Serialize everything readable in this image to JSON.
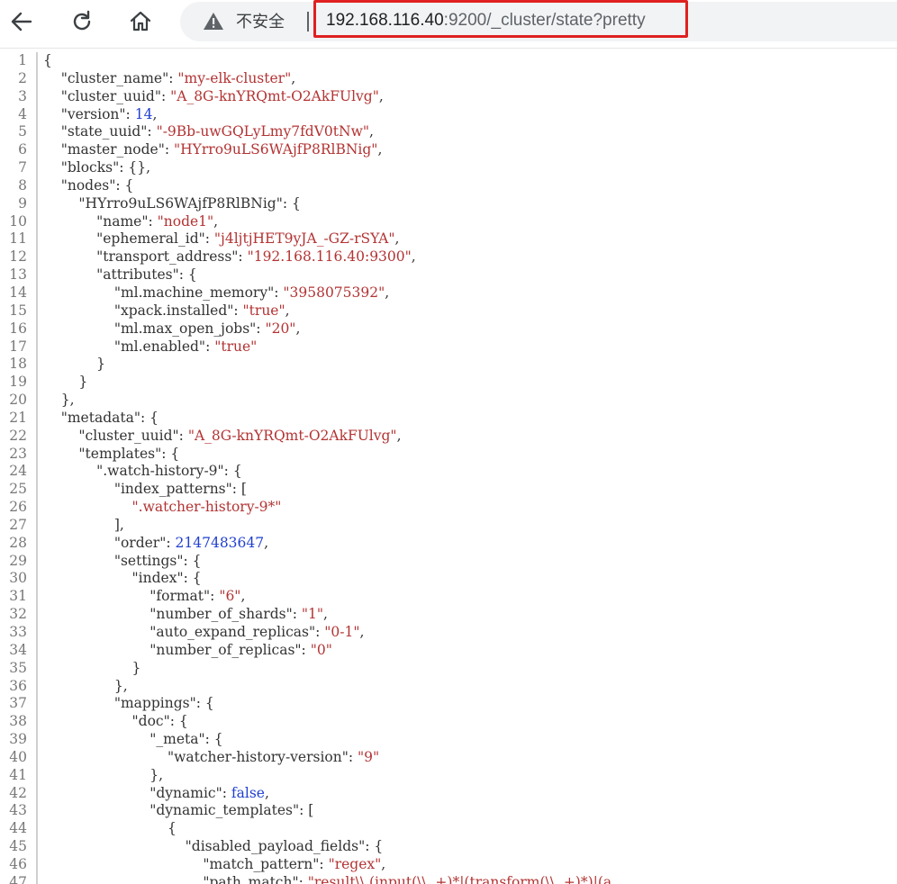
{
  "toolbar": {
    "security_label": "不安全",
    "url_host": "192.168.116.40",
    "url_path": ":9200/_cluster/state?pretty"
  },
  "colors": {
    "highlight_border": "#e02020",
    "string": "#b33333",
    "number": "#1f3fd0",
    "key": "#333333"
  },
  "icons": [
    "back-arrow-icon",
    "reload-icon",
    "home-icon",
    "warning-icon"
  ],
  "lines": [
    {
      "n": "1",
      "t": [
        [
          "p",
          "{"
        ]
      ]
    },
    {
      "n": "2",
      "t": [
        [
          "p",
          "    "
        ],
        [
          "k",
          "\"cluster_name\""
        ],
        [
          "p",
          ": "
        ],
        [
          "s",
          "\"my-elk-cluster\""
        ],
        [
          "p",
          ","
        ]
      ]
    },
    {
      "n": "3",
      "t": [
        [
          "p",
          "    "
        ],
        [
          "k",
          "\"cluster_uuid\""
        ],
        [
          "p",
          ": "
        ],
        [
          "s",
          "\"A_8G-knYRQmt-O2AkFUlvg\""
        ],
        [
          "p",
          ","
        ]
      ]
    },
    {
      "n": "4",
      "t": [
        [
          "p",
          "    "
        ],
        [
          "k",
          "\"version\""
        ],
        [
          "p",
          ": "
        ],
        [
          "n",
          "14"
        ],
        [
          "p",
          ","
        ]
      ]
    },
    {
      "n": "5",
      "t": [
        [
          "p",
          "    "
        ],
        [
          "k",
          "\"state_uuid\""
        ],
        [
          "p",
          ": "
        ],
        [
          "s",
          "\"-9Bb-uwGQLyLmy7fdV0tNw\""
        ],
        [
          "p",
          ","
        ]
      ]
    },
    {
      "n": "6",
      "t": [
        [
          "p",
          "    "
        ],
        [
          "k",
          "\"master_node\""
        ],
        [
          "p",
          ": "
        ],
        [
          "s",
          "\"HYrro9uLS6WAjfP8RlBNig\""
        ],
        [
          "p",
          ","
        ]
      ]
    },
    {
      "n": "7",
      "t": [
        [
          "p",
          "    "
        ],
        [
          "k",
          "\"blocks\""
        ],
        [
          "p",
          ": {},"
        ]
      ]
    },
    {
      "n": "8",
      "t": [
        [
          "p",
          "    "
        ],
        [
          "k",
          "\"nodes\""
        ],
        [
          "p",
          ": {"
        ]
      ]
    },
    {
      "n": "9",
      "t": [
        [
          "p",
          "        "
        ],
        [
          "k",
          "\"HYrro9uLS6WAjfP8RlBNig\""
        ],
        [
          "p",
          ": {"
        ]
      ]
    },
    {
      "n": "10",
      "t": [
        [
          "p",
          "            "
        ],
        [
          "k",
          "\"name\""
        ],
        [
          "p",
          ": "
        ],
        [
          "s",
          "\"node1\""
        ],
        [
          "p",
          ","
        ]
      ]
    },
    {
      "n": "11",
      "t": [
        [
          "p",
          "            "
        ],
        [
          "k",
          "\"ephemeral_id\""
        ],
        [
          "p",
          ": "
        ],
        [
          "s",
          "\"j4ljtjHET9yJA_-GZ-rSYA\""
        ],
        [
          "p",
          ","
        ]
      ]
    },
    {
      "n": "12",
      "t": [
        [
          "p",
          "            "
        ],
        [
          "k",
          "\"transport_address\""
        ],
        [
          "p",
          ": "
        ],
        [
          "s",
          "\"192.168.116.40:9300\""
        ],
        [
          "p",
          ","
        ]
      ]
    },
    {
      "n": "13",
      "t": [
        [
          "p",
          "            "
        ],
        [
          "k",
          "\"attributes\""
        ],
        [
          "p",
          ": {"
        ]
      ]
    },
    {
      "n": "14",
      "t": [
        [
          "p",
          "                "
        ],
        [
          "k",
          "\"ml.machine_memory\""
        ],
        [
          "p",
          ": "
        ],
        [
          "s",
          "\"3958075392\""
        ],
        [
          "p",
          ","
        ]
      ]
    },
    {
      "n": "15",
      "t": [
        [
          "p",
          "                "
        ],
        [
          "k",
          "\"xpack.installed\""
        ],
        [
          "p",
          ": "
        ],
        [
          "s",
          "\"true\""
        ],
        [
          "p",
          ","
        ]
      ]
    },
    {
      "n": "16",
      "t": [
        [
          "p",
          "                "
        ],
        [
          "k",
          "\"ml.max_open_jobs\""
        ],
        [
          "p",
          ": "
        ],
        [
          "s",
          "\"20\""
        ],
        [
          "p",
          ","
        ]
      ]
    },
    {
      "n": "17",
      "t": [
        [
          "p",
          "                "
        ],
        [
          "k",
          "\"ml.enabled\""
        ],
        [
          "p",
          ": "
        ],
        [
          "s",
          "\"true\""
        ]
      ]
    },
    {
      "n": "18",
      "t": [
        [
          "p",
          "            }"
        ]
      ]
    },
    {
      "n": "19",
      "t": [
        [
          "p",
          "        }"
        ]
      ]
    },
    {
      "n": "20",
      "t": [
        [
          "p",
          "    },"
        ]
      ]
    },
    {
      "n": "21",
      "t": [
        [
          "p",
          "    "
        ],
        [
          "k",
          "\"metadata\""
        ],
        [
          "p",
          ": {"
        ]
      ]
    },
    {
      "n": "22",
      "t": [
        [
          "p",
          "        "
        ],
        [
          "k",
          "\"cluster_uuid\""
        ],
        [
          "p",
          ": "
        ],
        [
          "s",
          "\"A_8G-knYRQmt-O2AkFUlvg\""
        ],
        [
          "p",
          ","
        ]
      ]
    },
    {
      "n": "23",
      "t": [
        [
          "p",
          "        "
        ],
        [
          "k",
          "\"templates\""
        ],
        [
          "p",
          ": {"
        ]
      ]
    },
    {
      "n": "24",
      "t": [
        [
          "p",
          "            "
        ],
        [
          "k",
          "\".watch-history-9\""
        ],
        [
          "p",
          ": {"
        ]
      ]
    },
    {
      "n": "25",
      "t": [
        [
          "p",
          "                "
        ],
        [
          "k",
          "\"index_patterns\""
        ],
        [
          "p",
          ": ["
        ]
      ]
    },
    {
      "n": "26",
      "t": [
        [
          "p",
          "                    "
        ],
        [
          "s",
          "\".watcher-history-9*\""
        ]
      ]
    },
    {
      "n": "27",
      "t": [
        [
          "p",
          "                ],"
        ]
      ]
    },
    {
      "n": "28",
      "t": [
        [
          "p",
          "                "
        ],
        [
          "k",
          "\"order\""
        ],
        [
          "p",
          ": "
        ],
        [
          "n",
          "2147483647"
        ],
        [
          "p",
          ","
        ]
      ]
    },
    {
      "n": "29",
      "t": [
        [
          "p",
          "                "
        ],
        [
          "k",
          "\"settings\""
        ],
        [
          "p",
          ": {"
        ]
      ]
    },
    {
      "n": "30",
      "t": [
        [
          "p",
          "                    "
        ],
        [
          "k",
          "\"index\""
        ],
        [
          "p",
          ": {"
        ]
      ]
    },
    {
      "n": "31",
      "t": [
        [
          "p",
          "                        "
        ],
        [
          "k",
          "\"format\""
        ],
        [
          "p",
          ": "
        ],
        [
          "s",
          "\"6\""
        ],
        [
          "p",
          ","
        ]
      ]
    },
    {
      "n": "32",
      "t": [
        [
          "p",
          "                        "
        ],
        [
          "k",
          "\"number_of_shards\""
        ],
        [
          "p",
          ": "
        ],
        [
          "s",
          "\"1\""
        ],
        [
          "p",
          ","
        ]
      ]
    },
    {
      "n": "33",
      "t": [
        [
          "p",
          "                        "
        ],
        [
          "k",
          "\"auto_expand_replicas\""
        ],
        [
          "p",
          ": "
        ],
        [
          "s",
          "\"0-1\""
        ],
        [
          "p",
          ","
        ]
      ]
    },
    {
      "n": "34",
      "t": [
        [
          "p",
          "                        "
        ],
        [
          "k",
          "\"number_of_replicas\""
        ],
        [
          "p",
          ": "
        ],
        [
          "s",
          "\"0\""
        ]
      ]
    },
    {
      "n": "35",
      "t": [
        [
          "p",
          "                    }"
        ]
      ]
    },
    {
      "n": "36",
      "t": [
        [
          "p",
          "                },"
        ]
      ]
    },
    {
      "n": "37",
      "t": [
        [
          "p",
          "                "
        ],
        [
          "k",
          "\"mappings\""
        ],
        [
          "p",
          ": {"
        ]
      ]
    },
    {
      "n": "38",
      "t": [
        [
          "p",
          "                    "
        ],
        [
          "k",
          "\"doc\""
        ],
        [
          "p",
          ": {"
        ]
      ]
    },
    {
      "n": "39",
      "t": [
        [
          "p",
          "                        "
        ],
        [
          "k",
          "\"_meta\""
        ],
        [
          "p",
          ": {"
        ]
      ]
    },
    {
      "n": "40",
      "t": [
        [
          "p",
          "                            "
        ],
        [
          "k",
          "\"watcher-history-version\""
        ],
        [
          "p",
          ": "
        ],
        [
          "s",
          "\"9\""
        ]
      ]
    },
    {
      "n": "41",
      "t": [
        [
          "p",
          "                        },"
        ]
      ]
    },
    {
      "n": "42",
      "t": [
        [
          "p",
          "                        "
        ],
        [
          "k",
          "\"dynamic\""
        ],
        [
          "p",
          ": "
        ],
        [
          "b",
          "false"
        ],
        [
          "p",
          ","
        ]
      ]
    },
    {
      "n": "43",
      "t": [
        [
          "p",
          "                        "
        ],
        [
          "k",
          "\"dynamic_templates\""
        ],
        [
          "p",
          ": ["
        ]
      ]
    },
    {
      "n": "44",
      "t": [
        [
          "p",
          "                            {"
        ]
      ]
    },
    {
      "n": "45",
      "t": [
        [
          "p",
          "                                "
        ],
        [
          "k",
          "\"disabled_payload_fields\""
        ],
        [
          "p",
          ": {"
        ]
      ]
    },
    {
      "n": "46",
      "t": [
        [
          "p",
          "                                    "
        ],
        [
          "k",
          "\"match_pattern\""
        ],
        [
          "p",
          ": "
        ],
        [
          "s",
          "\"regex\""
        ],
        [
          "p",
          ","
        ]
      ]
    },
    {
      "n": "47",
      "t": [
        [
          "p",
          "                                    "
        ],
        [
          "k",
          "\"path_match\""
        ],
        [
          "p",
          ": "
        ],
        [
          "s",
          "\"result\\\\.(input(\\\\..+)*|(transform(\\\\..+)*)|(a"
        ]
      ]
    }
  ]
}
